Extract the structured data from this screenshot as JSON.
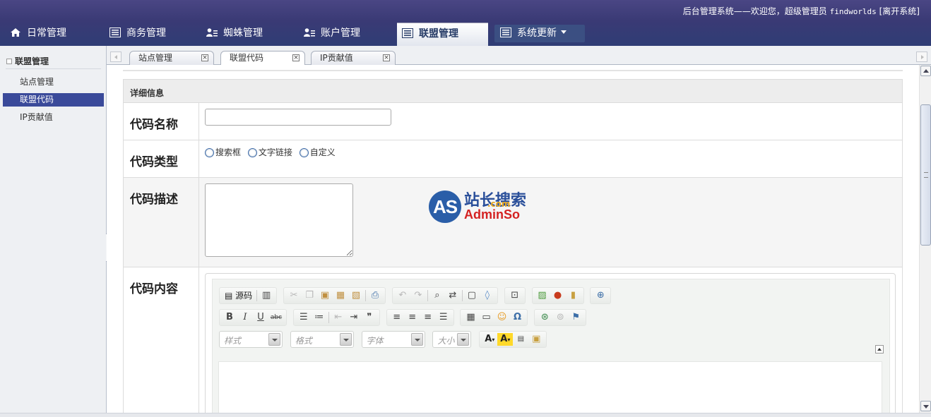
{
  "header": {
    "welcome_prefix": "后台管理系统——欢迎您，超级管理员 ",
    "username": "findworlds",
    "logout": " [离开系统]"
  },
  "nav": {
    "tabs": [
      {
        "label": "日常管理",
        "icon": "home-icon"
      },
      {
        "label": "商务管理",
        "icon": "list-icon"
      },
      {
        "label": "蜘蛛管理",
        "icon": "user-list-icon"
      },
      {
        "label": "账户管理",
        "icon": "user-list-icon"
      },
      {
        "label": "联盟管理",
        "icon": "list-icon",
        "active": true
      },
      {
        "label": "系统更新",
        "icon": "list-icon",
        "dropdown": true
      }
    ]
  },
  "sidebar": {
    "title": "联盟管理",
    "items": [
      {
        "label": "站点管理"
      },
      {
        "label": "联盟代码",
        "active": true
      },
      {
        "label": "IP贡献值"
      }
    ]
  },
  "page_tabs": [
    {
      "label": "站点管理",
      "close": "×"
    },
    {
      "label": "联盟代码",
      "close": "×",
      "active": true
    },
    {
      "label": "IP贡献值",
      "close": "×"
    }
  ],
  "form": {
    "section_title": "详细信息",
    "name_label": "代码名称",
    "name_value": "",
    "type_label": "代码类型",
    "type_options": [
      "搜索框",
      "文字链接",
      "自定义"
    ],
    "desc_label": "代码描述",
    "desc_value": "",
    "content_label": "代码内容"
  },
  "watermark": {
    "mark": "AS",
    "cn": "站长搜索",
    "en": "AdminSo",
    "sub": ".com"
  },
  "editor": {
    "source_label": "源码",
    "style_placeholder": "样式",
    "format_placeholder": "格式",
    "font_placeholder": "字体",
    "size_placeholder": "大小",
    "bold": "B",
    "italic": "I",
    "underline": "U",
    "strike": "abc",
    "quote": "❞",
    "omega": "Ω",
    "font_color": "A",
    "bg_color": "A"
  },
  "colors": {
    "header_bg": "#3a3a75",
    "active_side_item": "#3a4a9a",
    "section_bg": "#ededed"
  }
}
